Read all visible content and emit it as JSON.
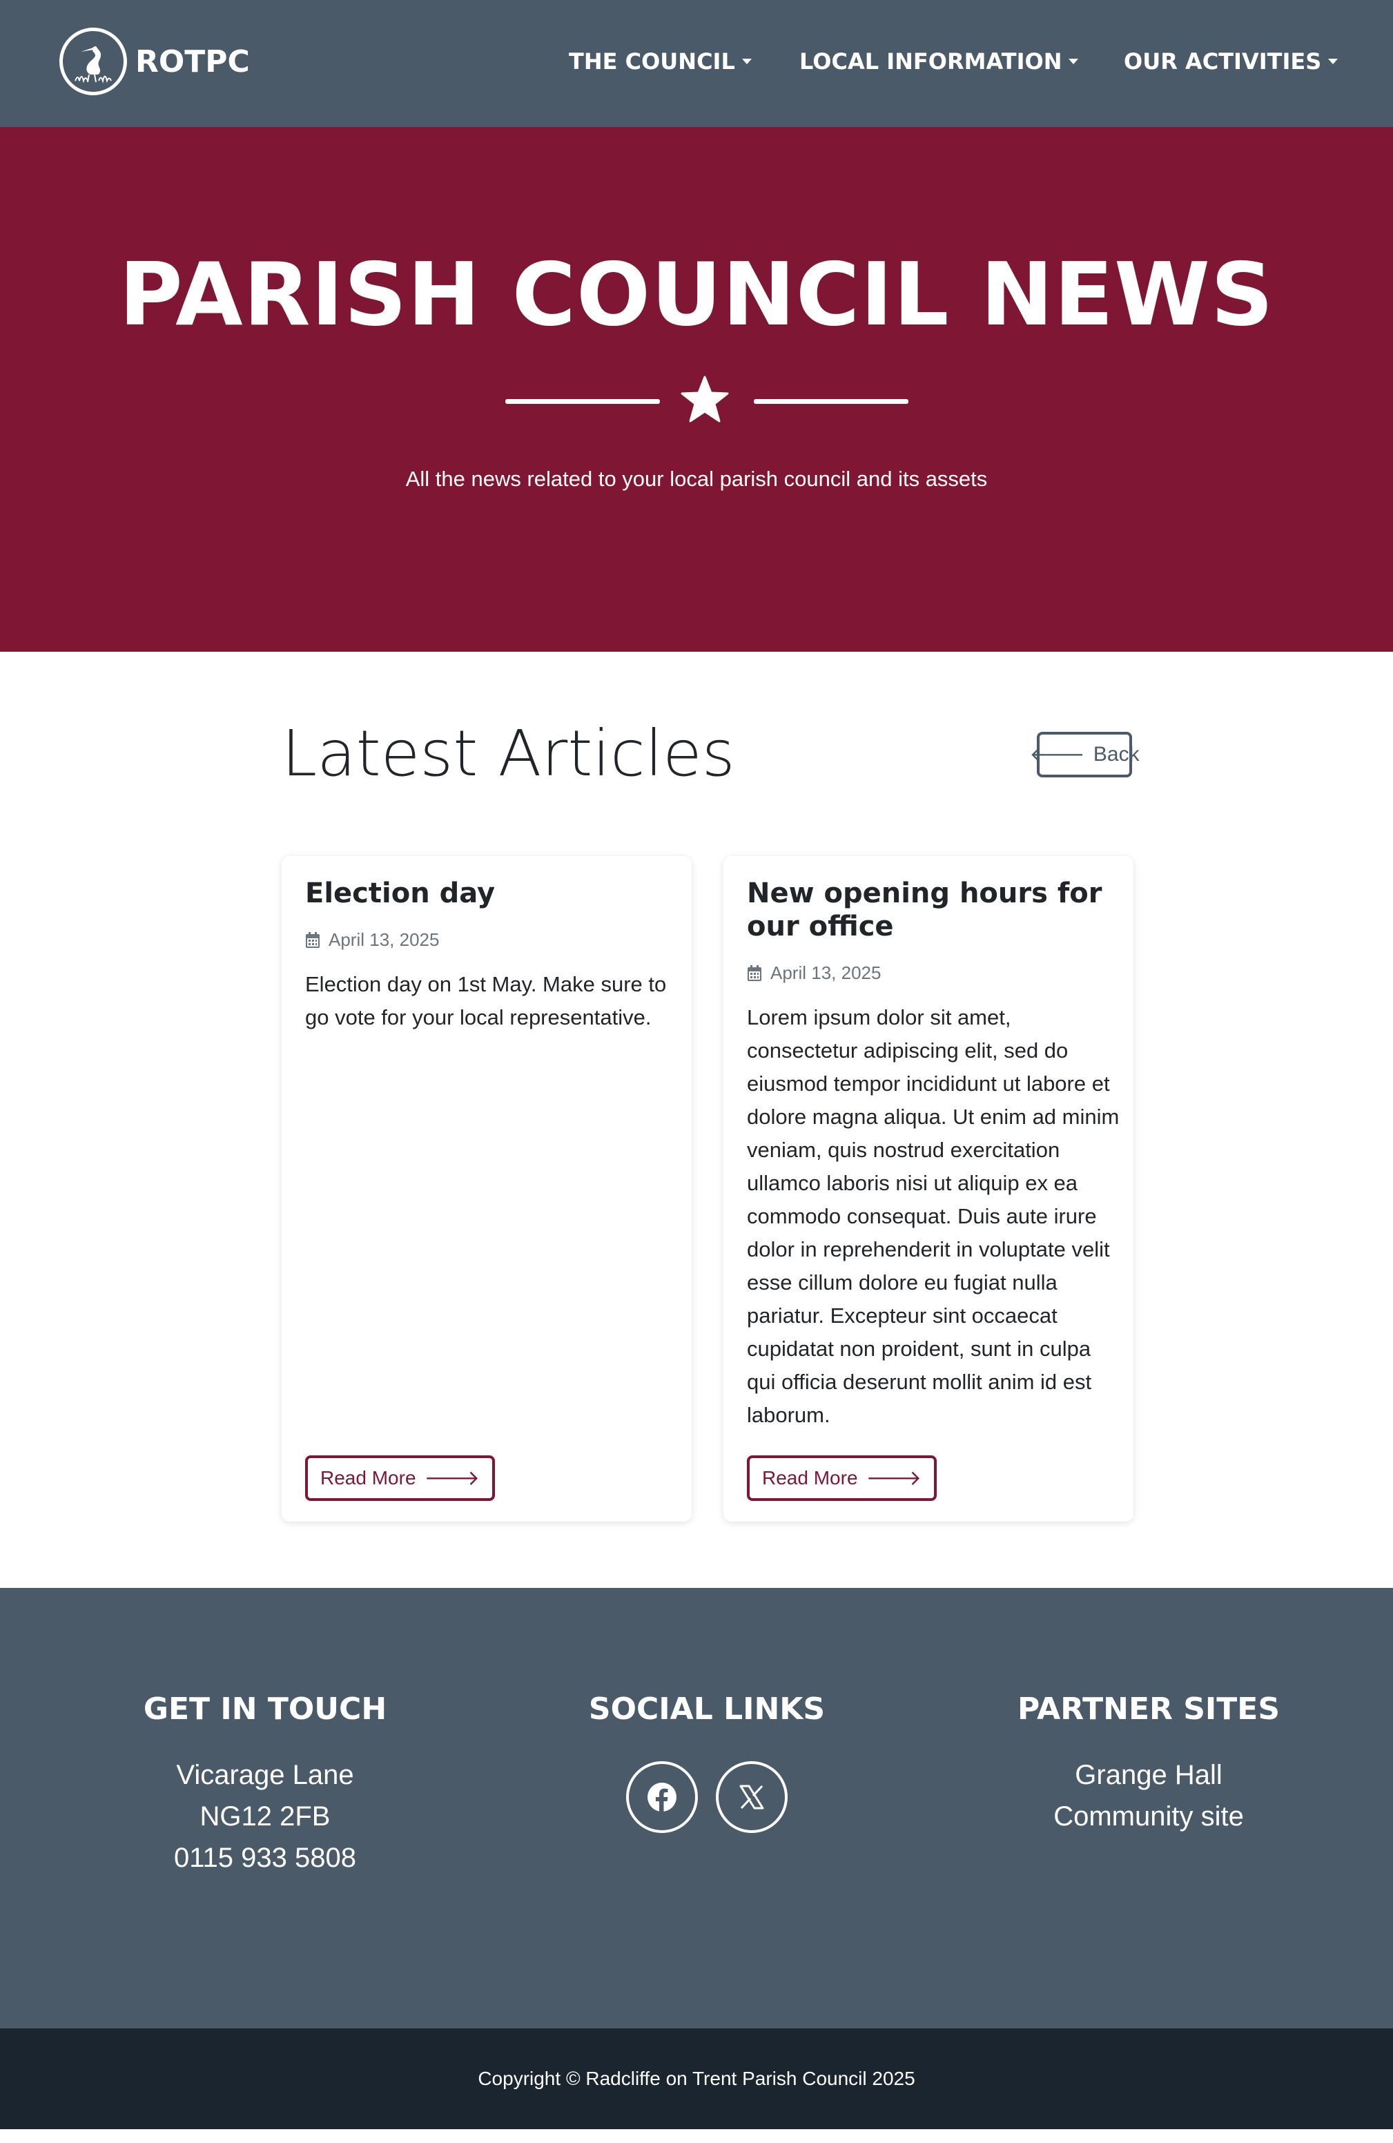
{
  "navbar": {
    "brand": "ROTPC",
    "items": [
      {
        "label": "THE COUNCIL"
      },
      {
        "label": "LOCAL INFORMATION"
      },
      {
        "label": "OUR ACTIVITIES"
      }
    ]
  },
  "hero": {
    "title": "PARISH COUNCIL NEWS",
    "subtitle": "All the news related to your local parish council and its assets"
  },
  "articles": {
    "heading": "Latest Articles",
    "back_label": "Back",
    "items": [
      {
        "title": "Election day",
        "date": "April 13, 2025",
        "body": "Election day on 1st May. Make sure to go vote for your local representative.",
        "read_more": "Read More"
      },
      {
        "title": "New opening hours for our office",
        "date": "April 13, 2025",
        "body": "Lorem ipsum dolor sit amet, consectetur adipiscing elit, sed do eiusmod tempor incididunt ut labore et dolore magna aliqua. Ut enim ad minim veniam, quis nostrud exercitation ullamco laboris nisi ut aliquip ex ea commodo consequat. Duis aute irure dolor in reprehenderit in voluptate velit esse cillum dolore eu fugiat nulla pariatur. Excepteur sint occaecat cupidatat non proident, sunt in culpa qui officia deserunt mollit anim id est laborum.",
        "read_more": "Read More"
      }
    ]
  },
  "footer": {
    "contact": {
      "heading": "GET IN TOUCH",
      "lines": [
        "Vicarage Lane",
        "NG12 2FB",
        "0115 933 5808"
      ]
    },
    "social": {
      "heading": "SOCIAL LINKS",
      "icons": [
        "facebook-icon",
        "x-twitter-icon"
      ]
    },
    "partners": {
      "heading": "PARTNER SITES",
      "links": [
        "Grange Hall",
        "Community site"
      ]
    },
    "copyright": "Copyright © Radcliffe on Trent Parish Council 2025"
  },
  "colors": {
    "navbar": "#4b5a69",
    "hero": "#7f1734",
    "accent": "#7f1734",
    "footer": "#4b5a69",
    "copyright_bar": "#1b252f"
  }
}
